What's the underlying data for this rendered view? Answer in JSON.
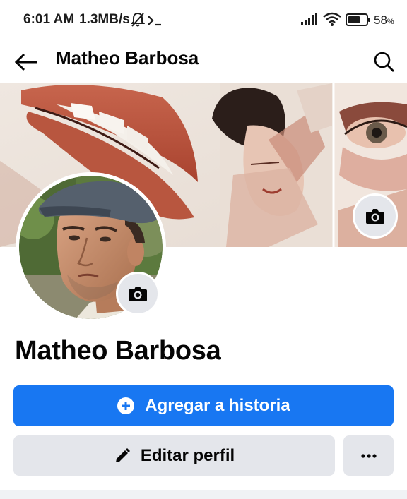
{
  "status_bar": {
    "time": "6:01 AM",
    "network_speed": "1.3MB/s",
    "battery_percent": "58",
    "battery_unit": "%",
    "icons": [
      "mute-notifications-icon",
      "terminal-icon",
      "signal-icon",
      "wifi-icon",
      "battery-icon"
    ]
  },
  "header": {
    "title": "Matheo Barbosa",
    "back_icon": "arrow-left-icon",
    "search_icon": "search-icon"
  },
  "profile": {
    "name": "Matheo Barbosa",
    "cover_camera_icon": "camera-icon",
    "avatar_camera_icon": "camera-icon"
  },
  "actions": {
    "add_story_label": "Agregar a historia",
    "edit_profile_label": "Editar perfil",
    "more_icon": "more-dots-icon"
  },
  "colors": {
    "primary_button": "#1877f2",
    "secondary_button": "#e4e6eb",
    "text": "#050505"
  }
}
